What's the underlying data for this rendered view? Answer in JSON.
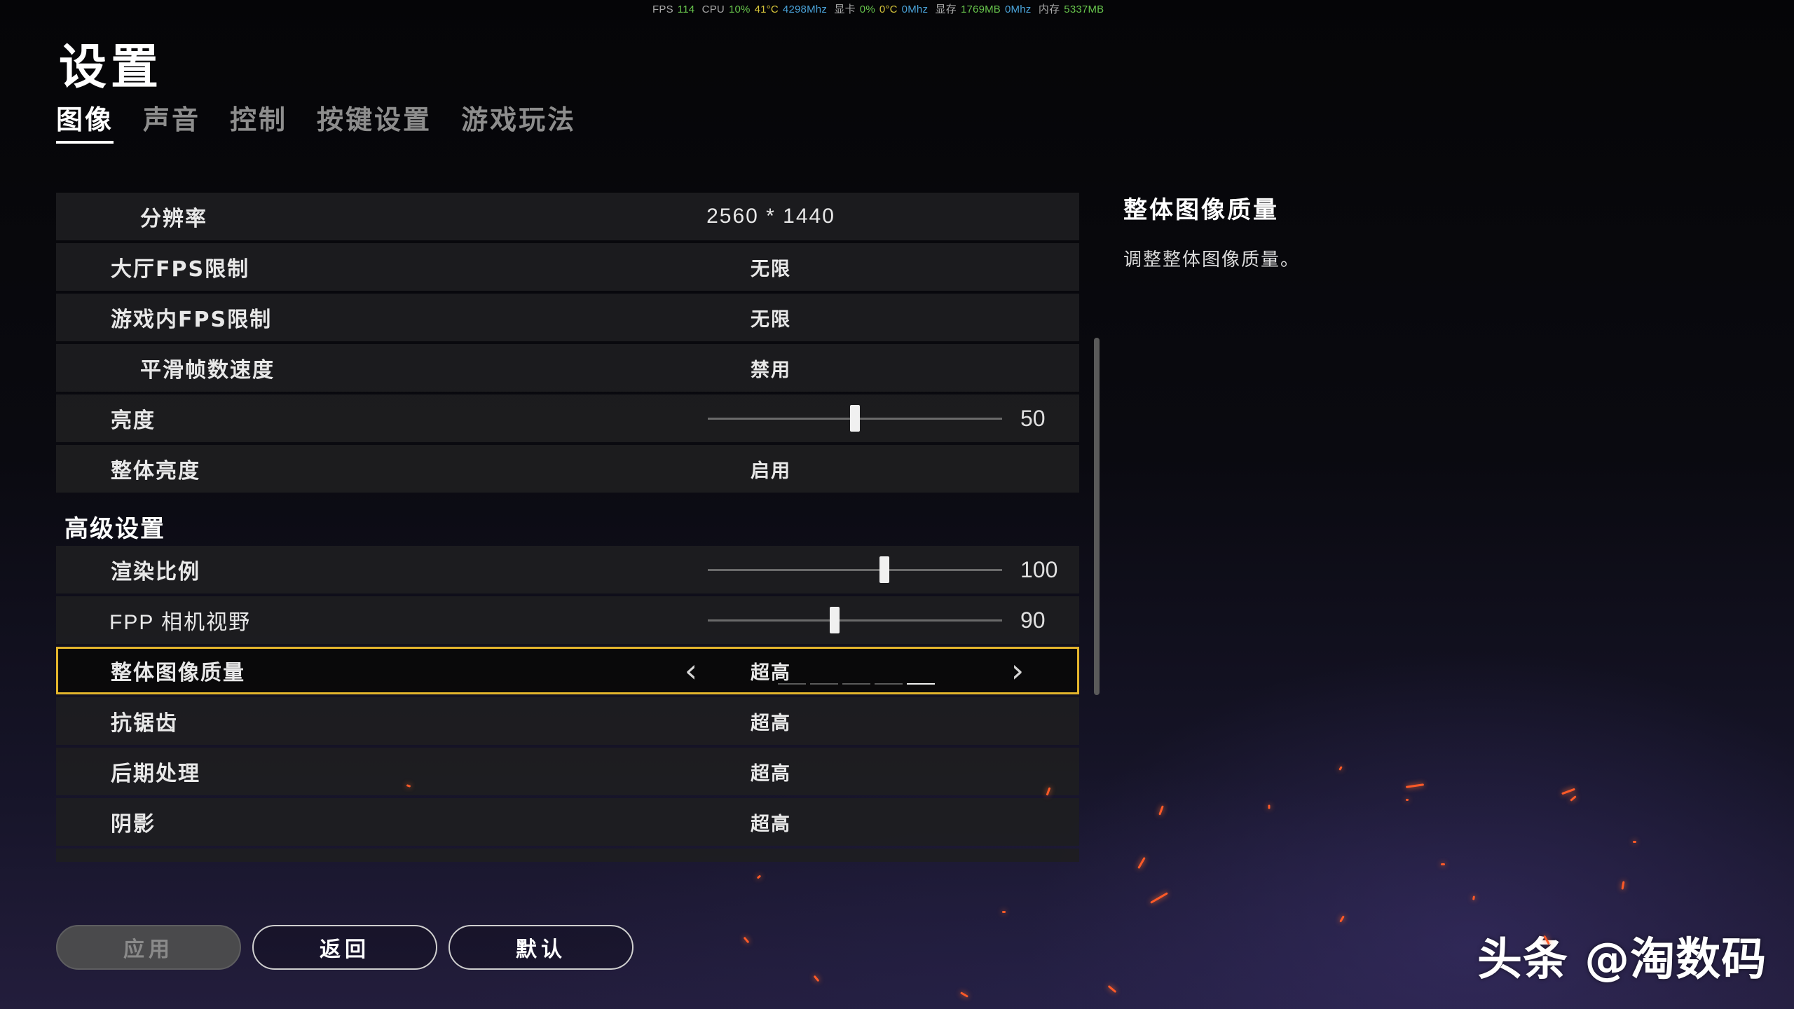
{
  "overlay": {
    "fps_label": "FPS",
    "fps_value": "114",
    "cpu_label": "CPU",
    "cpu_usage": "10%",
    "cpu_temp": "41°C",
    "cpu_clock": "4298Mhz",
    "gpu_label": "显卡",
    "gpu_usage": "0%",
    "gpu_temp": "0°C",
    "gpu_clock": "0Mhz",
    "vram_label": "显存",
    "vram_value": "1769MB",
    "vram_clock": "0Mhz",
    "ram_label": "内存",
    "ram_value": "5337MB"
  },
  "page_title": "设置",
  "tabs": [
    "图像",
    "声音",
    "控制",
    "按键设置",
    "游戏玩法"
  ],
  "rows": {
    "resolution": {
      "label": "分辨率",
      "value": "2560 * 1440"
    },
    "lobby_fps": {
      "label": "大厅FPS限制",
      "value": "无限"
    },
    "ingame_fps": {
      "label": "游戏内FPS限制",
      "value": "无限"
    },
    "smooth_frame": {
      "label": "平滑帧数速度",
      "value": "禁用"
    },
    "brightness": {
      "label": "亮度",
      "value": "50",
      "level": 0.5
    },
    "overall_brightness": {
      "label": "整体亮度",
      "value": "启用"
    }
  },
  "advanced": {
    "header": "高级设置",
    "render_scale": {
      "label": "渲染比例",
      "value": "100",
      "level": 0.6
    },
    "fpp_fov": {
      "label": "FPP 相机视野",
      "value": "90",
      "level": 0.43
    },
    "overall_quality": {
      "label": "整体图像质量",
      "value": "超高",
      "levels_total": 5,
      "level_selected": 5
    },
    "anti_aliasing": {
      "label": "抗锯齿",
      "value": "超高"
    },
    "post_processing": {
      "label": "后期处理",
      "value": "超高"
    },
    "shadows": {
      "label": "阴影",
      "value": "超高"
    }
  },
  "description": {
    "title": "整体图像质量",
    "text": "调整整体图像质量。"
  },
  "buttons": {
    "apply": "应用",
    "back": "返回",
    "default": "默认"
  },
  "watermark": "头条 @淘数码"
}
